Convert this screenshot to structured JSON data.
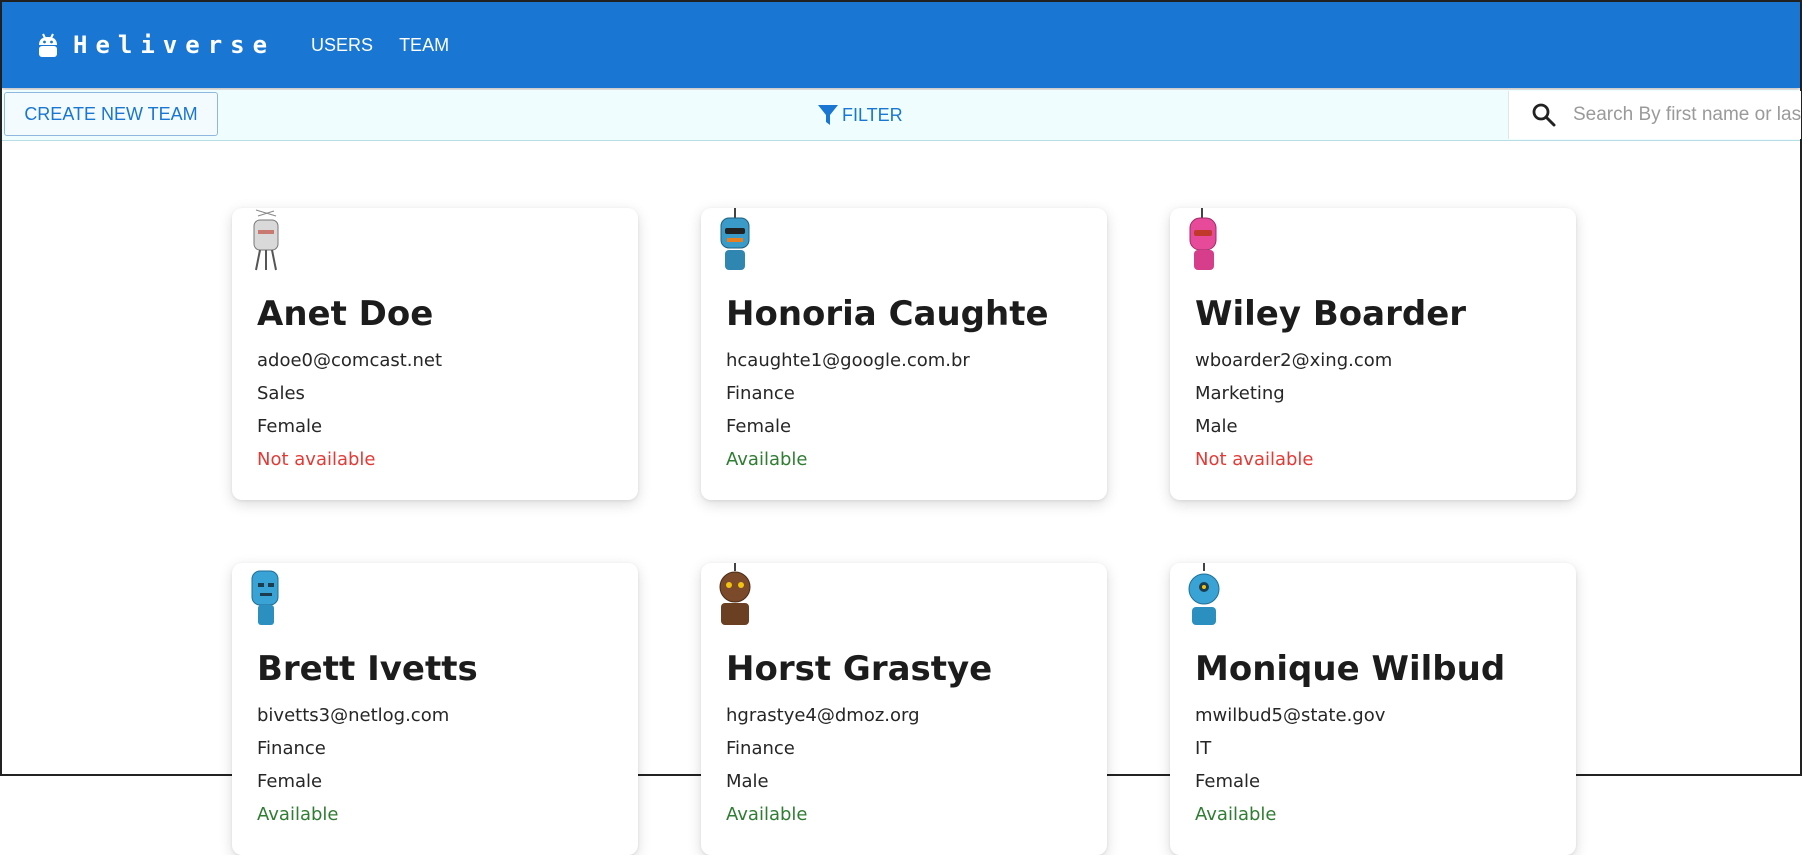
{
  "app": {
    "brand": "Heliverse",
    "nav": [
      {
        "label": "USERS"
      },
      {
        "label": "TEAM"
      }
    ]
  },
  "toolbar": {
    "create_label": "CREATE NEW TEAM",
    "filter_label": "FILTER",
    "search_placeholder": "Search By first name or last name"
  },
  "users": [
    {
      "name": "Anet Doe",
      "email": "adoe0@comcast.net",
      "domain": "Sales",
      "gender": "Female",
      "availability": "Not available",
      "available": false,
      "avatar_color": "#cfcfcf"
    },
    {
      "name": "Honoria Caughte",
      "email": "hcaughte1@google.com.br",
      "domain": "Finance",
      "gender": "Female",
      "availability": "Available",
      "available": true,
      "avatar_color": "#3a9bc9"
    },
    {
      "name": "Wiley Boarder",
      "email": "wboarder2@xing.com",
      "domain": "Marketing",
      "gender": "Male",
      "availability": "Not available",
      "available": false,
      "avatar_color": "#e84a9a"
    },
    {
      "name": "Brett Ivetts",
      "email": "bivetts3@netlog.com",
      "domain": "Finance",
      "gender": "Female",
      "availability": "Available",
      "available": true,
      "avatar_color": "#3aa3d6"
    },
    {
      "name": "Horst Grastye",
      "email": "hgrastye4@dmoz.org",
      "domain": "Finance",
      "gender": "Male",
      "availability": "Available",
      "available": true,
      "avatar_color": "#7a4a2a"
    },
    {
      "name": "Monique Wilbud",
      "email": "mwilbud5@state.gov",
      "domain": "IT",
      "gender": "Female",
      "availability": "Available",
      "available": true,
      "avatar_color": "#3aa3d6"
    }
  ],
  "colors": {
    "primary": "#1976d2",
    "available": "#2e7d32",
    "not_available": "#e53935"
  }
}
